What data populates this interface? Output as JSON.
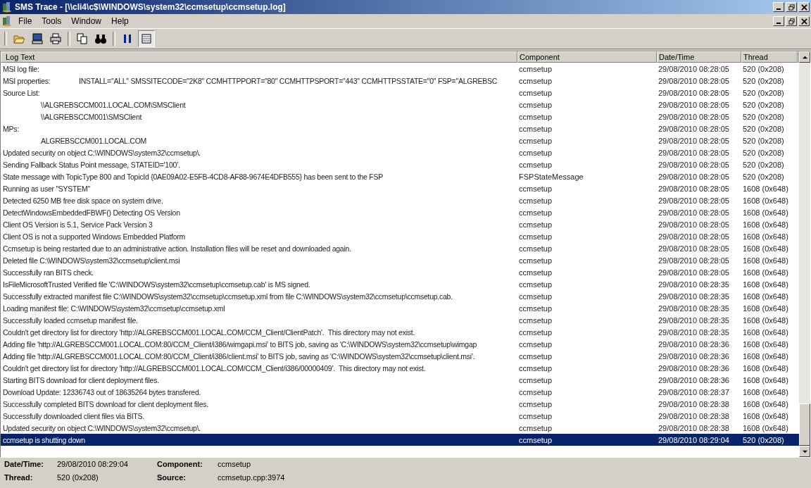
{
  "window": {
    "title": "SMS Trace - [\\\\cli4\\c$\\WINDOWS\\system32\\ccmsetup\\ccmsetup.log]"
  },
  "menu": [
    "File",
    "Tools",
    "Window",
    "Help"
  ],
  "table": {
    "columns": [
      "Log Text",
      "Component",
      "Date/Time",
      "Thread"
    ],
    "rows": [
      {
        "text": "MSI log file:",
        "component": "ccmsetup",
        "datetime": "29/08/2010 08:28:05",
        "thread": "520 (0x208)",
        "selected": false
      },
      {
        "text": "MSI properties:\tINSTALL=\"ALL\" SMSSITECODE=\"2K8\" CCMHTTPPORT=\"80\" CCMHTTPSPORT=\"443\" CCMHTTPSSTATE=\"0\" FSP=\"ALGREBSC",
        "component": "ccmsetup",
        "datetime": "29/08/2010 08:28:05",
        "thread": "520 (0x208)",
        "selected": false
      },
      {
        "text": "Source List:",
        "component": "ccmsetup",
        "datetime": "29/08/2010 08:28:05",
        "thread": "520 (0x208)",
        "selected": false
      },
      {
        "text": "\t\\\\ALGREBSCCM001.LOCAL.COM\\SMSClient",
        "component": "ccmsetup",
        "datetime": "29/08/2010 08:28:05",
        "thread": "520 (0x208)",
        "selected": false
      },
      {
        "text": "\t\\\\ALGREBSCCM001\\SMSClient",
        "component": "ccmsetup",
        "datetime": "29/08/2010 08:28:05",
        "thread": "520 (0x208)",
        "selected": false
      },
      {
        "text": "MPs:",
        "component": "ccmsetup",
        "datetime": "29/08/2010 08:28:05",
        "thread": "520 (0x208)",
        "selected": false
      },
      {
        "text": "\tALGREBSCCM001.LOCAL.COM",
        "component": "ccmsetup",
        "datetime": "29/08/2010 08:28:05",
        "thread": "520 (0x208)",
        "selected": false
      },
      {
        "text": "Updated security on object C:\\WINDOWS\\system32\\ccmsetup\\.",
        "component": "ccmsetup",
        "datetime": "29/08/2010 08:28:05",
        "thread": "520 (0x208)",
        "selected": false
      },
      {
        "text": "Sending Fallback Status Point message, STATEID='100'.",
        "component": "ccmsetup",
        "datetime": "29/08/2010 08:28:05",
        "thread": "520 (0x208)",
        "selected": false
      },
      {
        "text": "State message with TopicType 800 and TopicId {0AE09A02-E5FB-4CD8-AF88-9674E4DFB555} has been sent to the FSP",
        "component": "FSPStateMessage",
        "datetime": "29/08/2010 08:28:05",
        "thread": "520 (0x208)",
        "selected": false
      },
      {
        "text": "Running as user \"SYSTEM\"",
        "component": "ccmsetup",
        "datetime": "29/08/2010 08:28:05",
        "thread": "1608 (0x648)",
        "selected": false
      },
      {
        "text": "Detected 6250 MB free disk space on system drive.",
        "component": "ccmsetup",
        "datetime": "29/08/2010 08:28:05",
        "thread": "1608 (0x648)",
        "selected": false
      },
      {
        "text": "DetectWindowsEmbeddedFBWF() Detecting OS Version",
        "component": "ccmsetup",
        "datetime": "29/08/2010 08:28:05",
        "thread": "1608 (0x648)",
        "selected": false
      },
      {
        "text": "Client OS Version is 5.1, Service Pack Version 3",
        "component": "ccmsetup",
        "datetime": "29/08/2010 08:28:05",
        "thread": "1608 (0x648)",
        "selected": false
      },
      {
        "text": "Client OS is not a supported Windows Embedded Platform",
        "component": "ccmsetup",
        "datetime": "29/08/2010 08:28:05",
        "thread": "1608 (0x648)",
        "selected": false
      },
      {
        "text": "Ccmsetup is being restarted due to an administrative action. Installation files will be reset and downloaded again.",
        "component": "ccmsetup",
        "datetime": "29/08/2010 08:28:05",
        "thread": "1608 (0x648)",
        "selected": false
      },
      {
        "text": "Deleted file C:\\WINDOWS\\system32\\ccmsetup\\client.msi",
        "component": "ccmsetup",
        "datetime": "29/08/2010 08:28:05",
        "thread": "1608 (0x648)",
        "selected": false
      },
      {
        "text": "Successfully ran BITS check.",
        "component": "ccmsetup",
        "datetime": "29/08/2010 08:28:05",
        "thread": "1608 (0x648)",
        "selected": false
      },
      {
        "text": "IsFileMicrosoftTrusted Verified file 'C:\\WINDOWS\\system32\\ccmsetup\\ccmsetup.cab' is MS signed.",
        "component": "ccmsetup",
        "datetime": "29/08/2010 08:28:35",
        "thread": "1608 (0x648)",
        "selected": false
      },
      {
        "text": "Successfully extracted manifest file C:\\WINDOWS\\system32\\ccmsetup\\ccmsetup.xml from file C:\\WINDOWS\\system32\\ccmsetup\\ccmsetup.cab.",
        "component": "ccmsetup",
        "datetime": "29/08/2010 08:28:35",
        "thread": "1608 (0x648)",
        "selected": false
      },
      {
        "text": "Loading manifest file: C:\\WINDOWS\\system32\\ccmsetup\\ccmsetup.xml",
        "component": "ccmsetup",
        "datetime": "29/08/2010 08:28:35",
        "thread": "1608 (0x648)",
        "selected": false
      },
      {
        "text": "Successfully loaded ccmsetup manifest file.",
        "component": "ccmsetup",
        "datetime": "29/08/2010 08:28:35",
        "thread": "1608 (0x648)",
        "selected": false
      },
      {
        "text": "Couldn't get directory list for directory 'http://ALGREBSCCM001.LOCAL.COM/CCM_Client/ClientPatch'.  This directory may not exist.",
        "component": "ccmsetup",
        "datetime": "29/08/2010 08:28:35",
        "thread": "1608 (0x648)",
        "selected": false
      },
      {
        "text": "Adding file 'http://ALGREBSCCM001.LOCAL.COM:80/CCM_Client/i386/wimgapi.msi' to BITS job, saving as 'C:\\WINDOWS\\system32\\ccmsetup\\wimgap",
        "component": "ccmsetup",
        "datetime": "29/08/2010 08:28:36",
        "thread": "1608 (0x648)",
        "selected": false
      },
      {
        "text": "Adding file 'http://ALGREBSCCM001.LOCAL.COM:80/CCM_Client/i386/client.msi' to BITS job, saving as 'C:\\WINDOWS\\system32\\ccmsetup\\client.msi'.",
        "component": "ccmsetup",
        "datetime": "29/08/2010 08:28:36",
        "thread": "1608 (0x648)",
        "selected": false
      },
      {
        "text": "Couldn't get directory list for directory 'http://ALGREBSCCM001.LOCAL.COM/CCM_Client/i386/00000409'.  This directory may not exist.",
        "component": "ccmsetup",
        "datetime": "29/08/2010 08:28:36",
        "thread": "1608 (0x648)",
        "selected": false
      },
      {
        "text": "Starting BITS download for client deployment files.",
        "component": "ccmsetup",
        "datetime": "29/08/2010 08:28:36",
        "thread": "1608 (0x648)",
        "selected": false
      },
      {
        "text": "Download Update: 12336743 out of 18635264 bytes transfered.",
        "component": "ccmsetup",
        "datetime": "29/08/2010 08:28:37",
        "thread": "1608 (0x648)",
        "selected": false
      },
      {
        "text": "Successfully completed BITS download for client deployment files.",
        "component": "ccmsetup",
        "datetime": "29/08/2010 08:28:38",
        "thread": "1608 (0x648)",
        "selected": false
      },
      {
        "text": "Successfully downloaded client files via BITS.",
        "component": "ccmsetup",
        "datetime": "29/08/2010 08:28:38",
        "thread": "1608 (0x648)",
        "selected": false
      },
      {
        "text": "Updated security on object C:\\WINDOWS\\system32\\ccmsetup\\.",
        "component": "ccmsetup",
        "datetime": "29/08/2010 08:28:38",
        "thread": "1608 (0x648)",
        "selected": false
      },
      {
        "text": "ccmsetup is shutting down",
        "component": "ccmsetup",
        "datetime": "29/08/2010 08:29:04",
        "thread": "520 (0x208)",
        "selected": true
      }
    ]
  },
  "details": [
    {
      "label": "Date/Time:",
      "value": "29/08/2010 08:29:04"
    },
    {
      "label": "Component:",
      "value": "ccmsetup"
    },
    {
      "label": "Thread:",
      "value": "520 (0x208)"
    },
    {
      "label": "Source:",
      "value": "ccmsetup.cpp:3974"
    }
  ]
}
